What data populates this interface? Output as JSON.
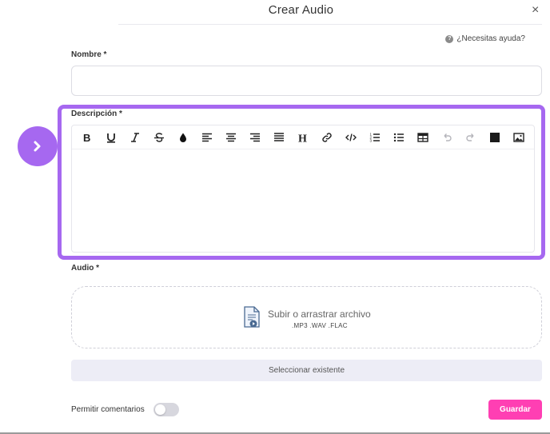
{
  "modal": {
    "title": "Crear Audio",
    "close_glyph": "×",
    "help_text": "¿Necesitas ayuda?",
    "help_glyph": "?"
  },
  "fields": {
    "name_label": "Nombre *",
    "name_value": "",
    "name_placeholder": "",
    "description_label": "Descripción *",
    "audio_label": "Audio *"
  },
  "toolbar": {
    "buttons": [
      "bold",
      "underline",
      "italic",
      "strikethrough",
      "text-color",
      "align-left",
      "align-center",
      "align-right",
      "align-justify",
      "heading",
      "link",
      "code",
      "ordered-list",
      "unordered-list",
      "table",
      "undo",
      "redo",
      "color-block",
      "image"
    ]
  },
  "dropzone": {
    "title": "Subir o arrastrar archivo",
    "formats": ".MP3 .WAV .FLAC"
  },
  "actions": {
    "select_existing": "Seleccionar existente",
    "comments_label": "Permitir comentarios",
    "comments_enabled": false,
    "save": "Guardar"
  },
  "colors": {
    "accent_purple": "#a668f0",
    "save_pink": "#ff3fb3",
    "select_bg": "#ededf6"
  }
}
